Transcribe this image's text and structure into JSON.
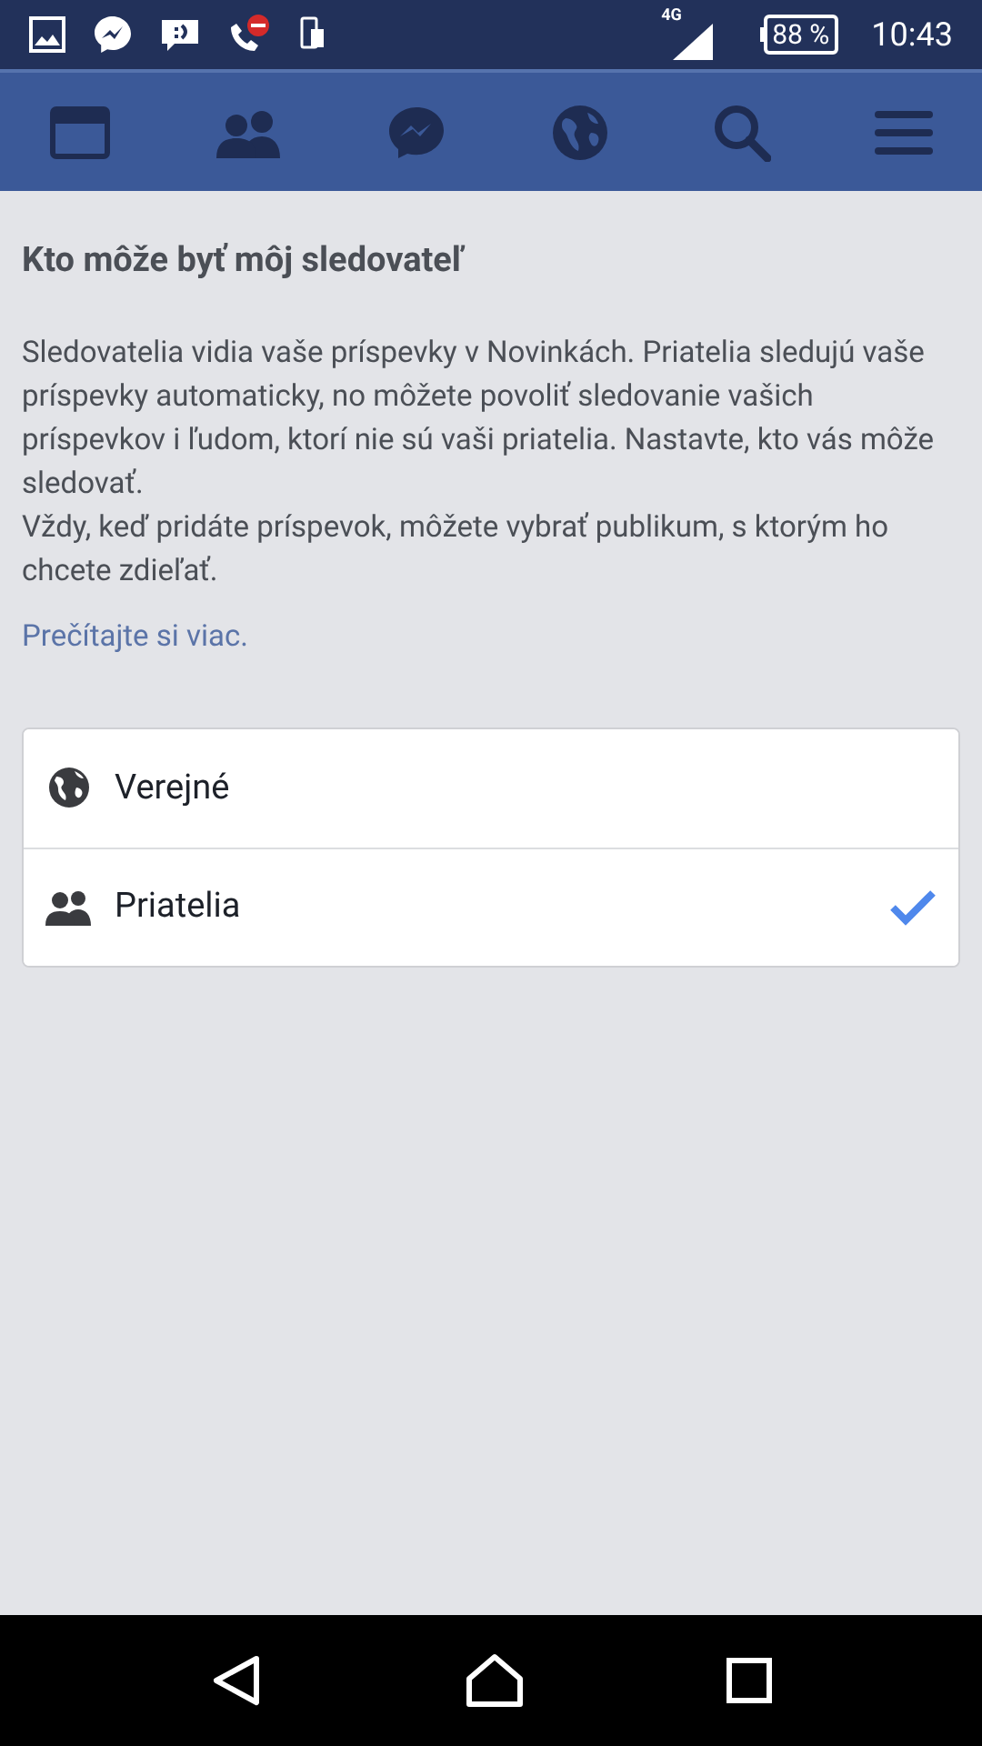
{
  "status_bar": {
    "network": "4G",
    "battery": "88 %",
    "time": "10:43"
  },
  "title": "Kto môže byť môj sledovateľ",
  "description": [
    "Sledovatelia vidia vaše príspevky v Novinkách. Priatelia sledujú vaše príspevky automaticky, no môžete povoliť sledovanie vašich príspevkov i ľudom, ktorí nie sú vaši priatelia. Nastavte, kto vás môže sledovať.",
    "Vždy, keď pridáte príspevok, môžete vybrať publikum, s ktorým ho chcete zdieľať."
  ],
  "learn_more_link": "Prečítajte si viac.",
  "options": [
    {
      "kind": "globe",
      "label": "Verejné",
      "selected": false
    },
    {
      "kind": "friends",
      "label": "Priatelia",
      "selected": true
    }
  ]
}
